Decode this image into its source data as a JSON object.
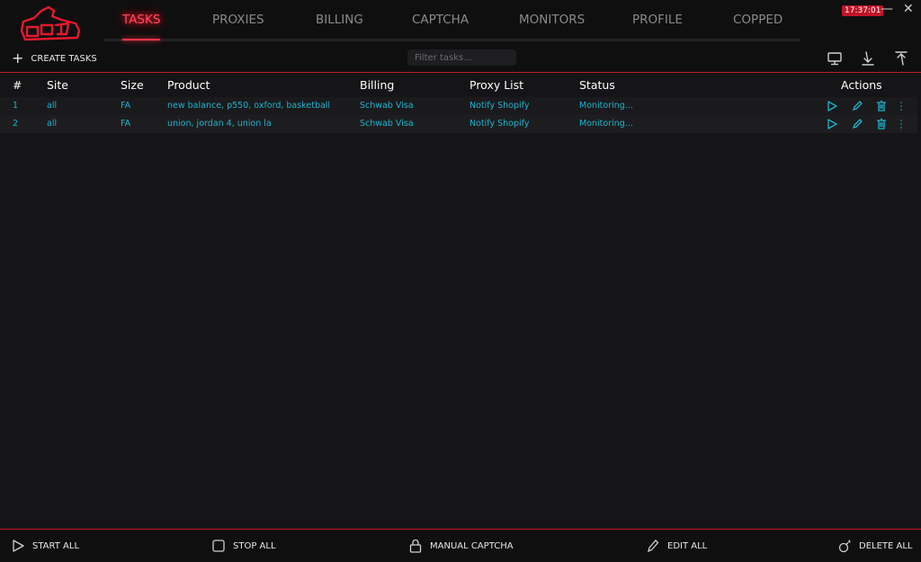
{
  "header": {
    "tabs": [
      {
        "label": "TASKS",
        "active": true
      },
      {
        "label": "PROXIES"
      },
      {
        "label": "BILLING"
      },
      {
        "label": "CAPTCHA"
      },
      {
        "label": "MONITORS"
      },
      {
        "label": "PROFILE"
      },
      {
        "label": "COPPED"
      }
    ],
    "clock": "17:37:01",
    "minimize_glyph": "—",
    "close_glyph": "✕"
  },
  "toolbar": {
    "create_label": "CREATE TASKS",
    "filter_placeholder": "Filter tasks...",
    "icons": [
      "monitor-icon",
      "import-icon",
      "export-icon"
    ]
  },
  "table": {
    "headers": [
      "#",
      "Site",
      "Size",
      "Product",
      "Billing",
      "Proxy List",
      "Status",
      "Actions"
    ],
    "rows": [
      {
        "num": "1",
        "site": "all",
        "size": "FA",
        "product": "new balance, p550, oxford, basketball",
        "billing": "Schwab Visa",
        "proxy": "Notify Shopify",
        "status": "Monitoring..."
      },
      {
        "num": "2",
        "site": "all",
        "size": "FA",
        "product": "union, jordan 4, union la",
        "billing": "Schwab Visa",
        "proxy": "Notify Shopify",
        "status": "Monitoring..."
      }
    ],
    "row_actions": [
      "play-icon",
      "edit-icon",
      "trash-icon",
      "more-icon"
    ]
  },
  "footer": {
    "start_all": "START ALL",
    "stop_all": "STOP ALL",
    "manual_captcha": "MANUAL CAPTCHA",
    "edit_all": "EDIT ALL",
    "delete_all": "DELETE ALL"
  },
  "colors": {
    "accent_red": "#ff3347",
    "cell_cyan": "#1fb3cc",
    "background": "#151517"
  }
}
